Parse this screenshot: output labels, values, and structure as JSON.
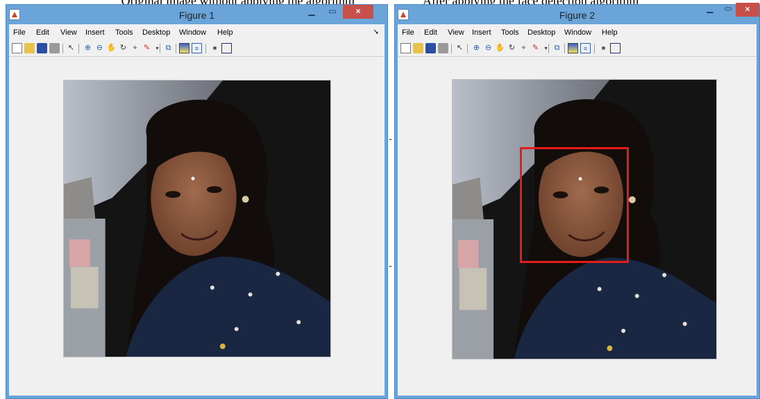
{
  "windows": [
    {
      "title": "Figure 1",
      "menu": [
        "File",
        "Edit",
        "View",
        "Insert",
        "Tools",
        "Desktop",
        "Window",
        "Help"
      ],
      "close_glyph": "×"
    },
    {
      "title": "Figure 2",
      "menu": [
        "File",
        "Edit",
        "View",
        "Insert",
        "Tools",
        "Desktop",
        "Window",
        "Help"
      ],
      "close_glyph": "×"
    }
  ],
  "toolbar_icons": [
    "new-figure-icon",
    "open-file-icon",
    "save-icon",
    "print-icon",
    "pointer-icon",
    "zoom-in-icon",
    "zoom-out-icon",
    "pan-icon",
    "rotate-3d-icon",
    "data-cursor-icon",
    "brush-icon",
    "link-plot-icon",
    "colorbar-icon",
    "legend-icon",
    "hide-plot-tools-icon",
    "show-plot-tools-icon"
  ],
  "colors": {
    "title_bar": "#6aa4d8",
    "client": "#f0f0f0",
    "close_button": "#c7504a",
    "detection_box": "#e81b1b"
  },
  "image_content": "portrait photo of a smiling woman; Figure 2 overlays a red face-detection bounding box"
}
